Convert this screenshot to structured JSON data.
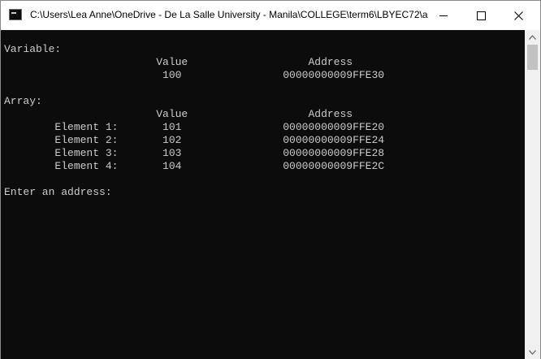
{
  "window": {
    "title": "C:\\Users\\Lea Anne\\OneDrive - De La Salle University - Manila\\COLLEGE\\term6\\LBYEC72\\a..."
  },
  "console": {
    "lines": [
      "Variable:",
      "                        Value                   Address",
      "                         100                00000000009FFE30",
      "",
      "Array:",
      "                        Value                   Address",
      "        Element 1:       101                00000000009FFE20",
      "        Element 2:       102                00000000009FFE24",
      "        Element 3:       103                00000000009FFE28",
      "        Element 4:       104                00000000009FFE2C",
      "",
      "Enter an address:"
    ]
  },
  "icons": {
    "app": "console-app-icon",
    "minimize": "minimize-icon",
    "maximize": "maximize-icon",
    "close": "close-icon",
    "scroll_up": "scroll-up-arrow-icon",
    "scroll_down": "scroll-down-arrow-icon"
  },
  "colors": {
    "console_bg": "#0c0c0c",
    "console_text": "#cccccc",
    "titlebar_bg": "#ffffff"
  }
}
